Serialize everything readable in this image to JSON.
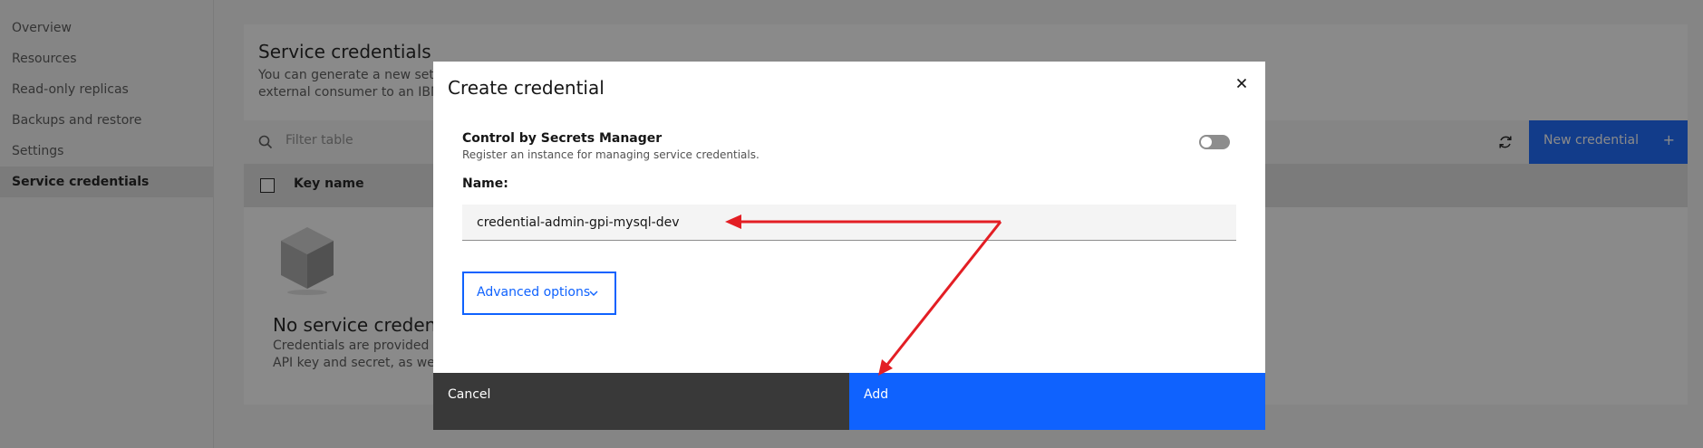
{
  "sidebar": {
    "items": [
      {
        "label": "Overview"
      },
      {
        "label": "Resources"
      },
      {
        "label": "Read-only replicas"
      },
      {
        "label": "Backups and restore"
      },
      {
        "label": "Settings"
      },
      {
        "label": "Service credentials",
        "active": true
      }
    ]
  },
  "page": {
    "title": "Service credentials",
    "desc_line1": "You can generate a new set of",
    "desc_line2": "external consumer to an IBM C",
    "toolbar": {
      "filter_placeholder": "Filter table",
      "new_button_label": "New credential",
      "new_button_icon": "+"
    },
    "table": {
      "columns": [
        "Key name"
      ]
    },
    "empty_state": {
      "title": "No service credentia",
      "desc_line1": "Credentials are provided in",
      "desc_line2": "API key and secret, as well"
    }
  },
  "modal": {
    "title": "Create credential",
    "close_icon": "×",
    "toggle_label": "Control by Secrets Manager",
    "toggle_help": "Register an instance for managing service credentials.",
    "toggle_on": false,
    "name_label": "Name:",
    "name_value": "credential-admin-gpi-mysql-dev",
    "advanced_label": "Advanced options",
    "cancel_label": "Cancel",
    "add_label": "Add"
  },
  "colors": {
    "primary": "#0f62fe",
    "secondary_button": "#393939",
    "annotation_arrow": "#e31e24"
  }
}
